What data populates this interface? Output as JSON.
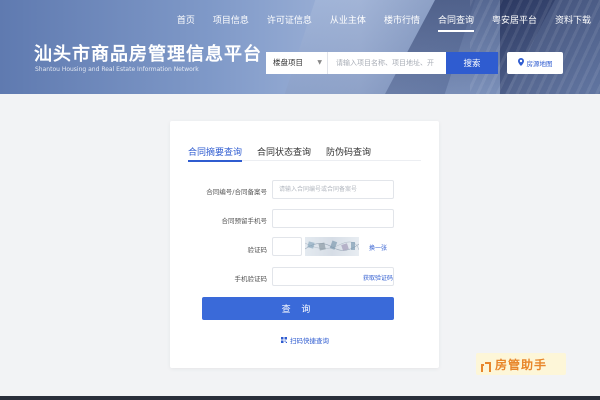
{
  "nav": {
    "items": [
      {
        "label": "首页",
        "active": false
      },
      {
        "label": "项目信息",
        "active": false
      },
      {
        "label": "许可证信息",
        "active": false
      },
      {
        "label": "从业主体",
        "active": false
      },
      {
        "label": "楼市行情",
        "active": false
      },
      {
        "label": "合同查询",
        "active": true
      },
      {
        "label": "粤安居平台",
        "active": false
      },
      {
        "label": "资料下载",
        "active": false
      }
    ]
  },
  "header": {
    "title": "汕头市商品房管理信息平台",
    "subtitle": "Shantou Housing and Real Estate Information Network"
  },
  "search": {
    "select_value": "楼盘项目",
    "placeholder": "请输入项目名称、项目地址、开",
    "button_label": "搜索",
    "map_label": "房源地图"
  },
  "card": {
    "tabs": [
      {
        "label": "合同摘要查询",
        "active": true
      },
      {
        "label": "合同状态查询",
        "active": false
      },
      {
        "label": "防伪码查询",
        "active": false
      }
    ],
    "fields": {
      "contract_no": {
        "label": "合同编号/合同备案号",
        "placeholder": "请输入合同编号或合同备案号"
      },
      "phone": {
        "label": "合同预留手机号",
        "placeholder": ""
      },
      "captcha": {
        "label": "验证码",
        "placeholder": "",
        "refresh_label": "换一张"
      },
      "sms": {
        "label": "手机验证码",
        "placeholder": "",
        "send_label": "获取验证码"
      }
    },
    "query_label": "查 询",
    "qr_label": "扫码快捷查询"
  },
  "watermark": {
    "text": "房管助手"
  },
  "colors": {
    "primary": "#2f5cd0",
    "button": "#3a6ad9",
    "watermark": "#e8862a"
  }
}
